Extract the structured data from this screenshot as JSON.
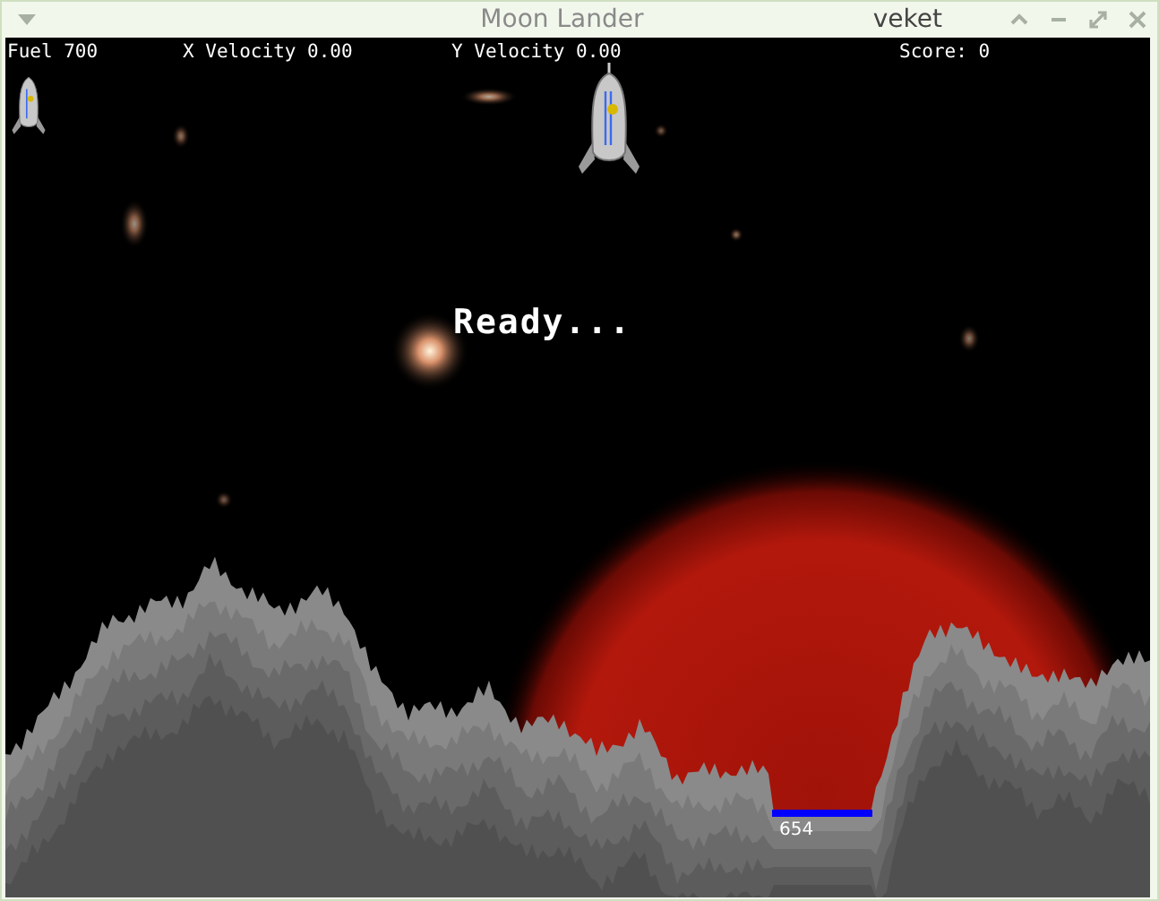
{
  "window": {
    "title": "Moon Lander",
    "user": "veket"
  },
  "hud": [
    {
      "label": "Fuel",
      "value": "700"
    },
    {
      "label": "X Velocity",
      "value": "0.00"
    },
    {
      "label": "Y Velocity",
      "value": "0.00"
    },
    {
      "label": "Score:",
      "value": "0"
    }
  ],
  "message": "Ready...",
  "landing_pad": {
    "label": "654"
  }
}
